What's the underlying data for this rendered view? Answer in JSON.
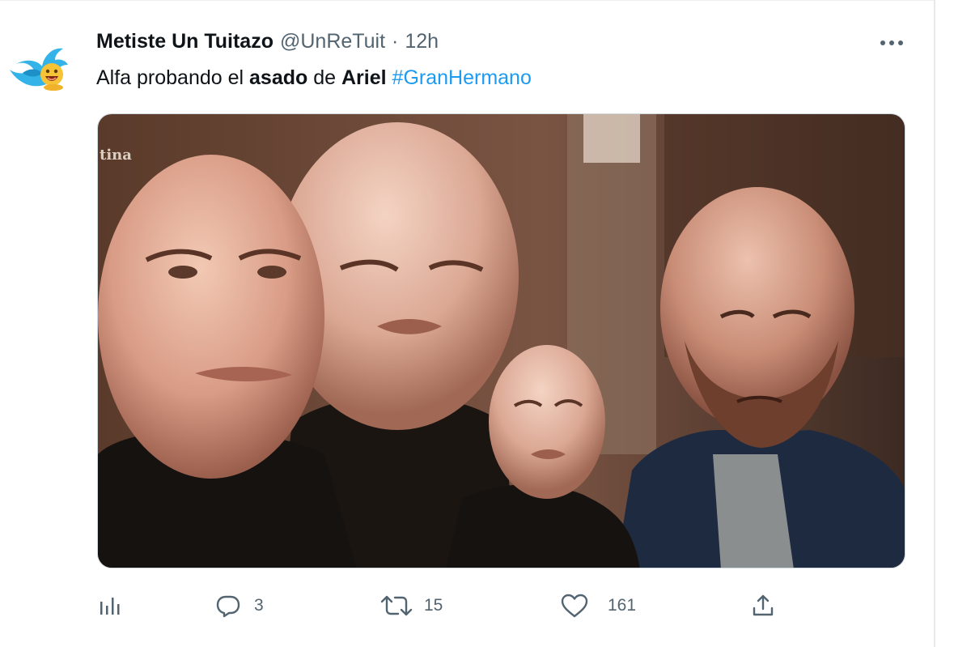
{
  "tweet": {
    "author_name": "Metiste Un Tuitazo",
    "author_handle": "@UnReTuit",
    "separator": "·",
    "time": "12h",
    "text": {
      "part1": "Alfa probando el ",
      "bold1": "asado",
      "part2": " de ",
      "bold2": "Ariel",
      "part3": " ",
      "hashtag": "#GranHermano"
    },
    "media": {
      "watermark": "tina",
      "alt_icon": "photo-collage"
    },
    "actions": {
      "analytics_icon": "bar-chart-icon",
      "reply_icon": "reply-icon",
      "reply_count": "3",
      "retweet_icon": "retweet-icon",
      "retweet_count": "15",
      "like_icon": "heart-icon",
      "like_count": "161",
      "share_icon": "share-icon"
    },
    "more_icon": "more-dots-icon"
  },
  "colors": {
    "link": "#1d9bf0",
    "secondary_text": "#536471",
    "primary_text": "#0f1419",
    "border": "#cfd9de"
  }
}
